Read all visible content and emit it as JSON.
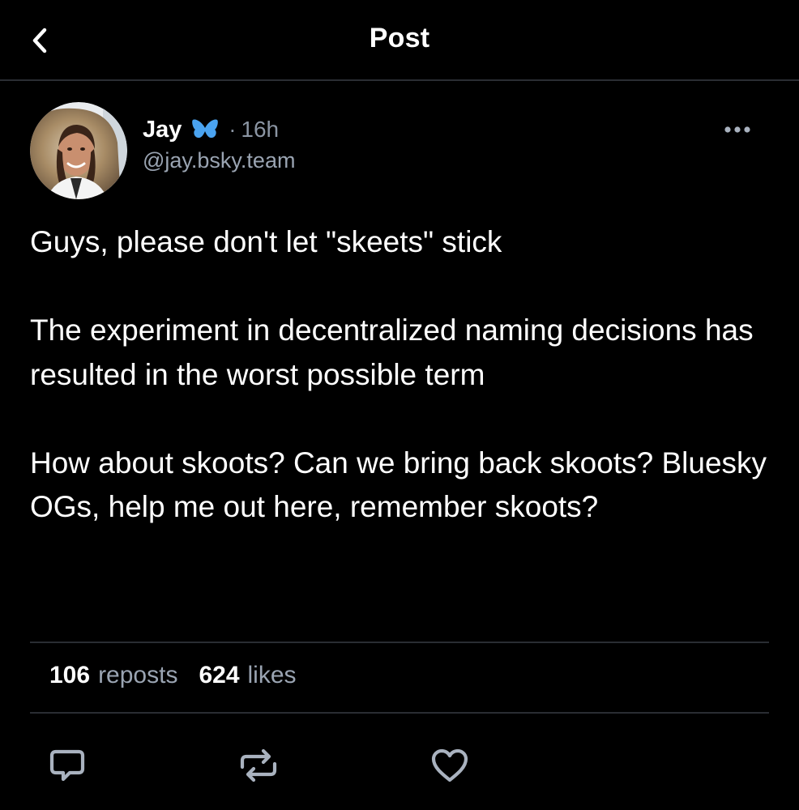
{
  "header": {
    "title": "Post",
    "back_icon": "chevron-left-icon"
  },
  "post": {
    "author": {
      "display_name": "Jay",
      "handle": "@jay.bsky.team",
      "badge_icon": "butterfly-icon",
      "badge_color": "#4aa3f0"
    },
    "separator": "·",
    "timestamp": "16h",
    "more_icon": "ellipsis-icon",
    "body": {
      "paragraph_1": "Guys, please don't let \"skeets\" stick",
      "paragraph_2": "The experiment in decentralized naming decisions has resulted in the worst possible term",
      "paragraph_3": "How about skoots? Can we bring back skoots? Bluesky OGs, help me out here, remember skoots?"
    },
    "stats": {
      "reposts_count": "106",
      "reposts_label": "reposts",
      "likes_count": "624",
      "likes_label": "likes"
    },
    "actions": {
      "reply_icon": "reply-bubble-icon",
      "repost_icon": "repost-icon",
      "like_icon": "heart-icon"
    }
  },
  "colors": {
    "background": "#000000",
    "text_primary": "#ffffff",
    "text_secondary": "#9aa4b2",
    "divider": "#2a2d33",
    "icon": "#a9b2bf"
  }
}
